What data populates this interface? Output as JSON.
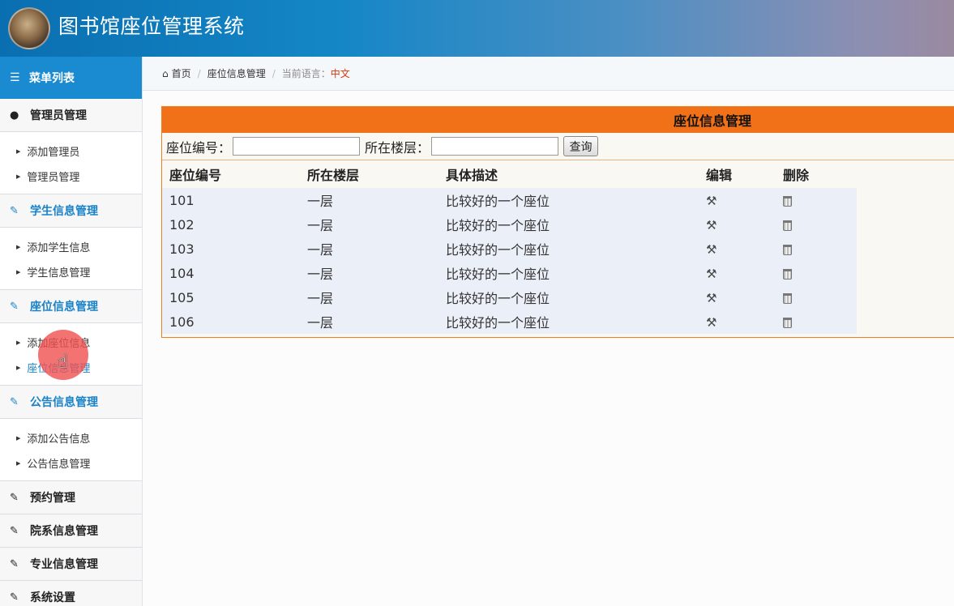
{
  "header": {
    "title": "图书馆座位管理系统",
    "logo_icon": "avatar"
  },
  "sidebar": {
    "menu_title": "菜单列表",
    "menu_icon": "list-icon",
    "groups": [
      {
        "label": "管理员管理",
        "icon": "user-icon",
        "items": [
          {
            "label": "添加管理员"
          },
          {
            "label": "管理员管理"
          }
        ]
      },
      {
        "label": "学生信息管理",
        "icon": "edit-icon",
        "items": [
          {
            "label": "添加学生信息"
          },
          {
            "label": "学生信息管理"
          }
        ]
      },
      {
        "label": "座位信息管理",
        "icon": "edit-icon",
        "items": [
          {
            "label": "添加座位信息"
          },
          {
            "label": "座位信息管理"
          }
        ]
      },
      {
        "label": "公告信息管理",
        "icon": "edit-icon",
        "items": [
          {
            "label": "添加公告信息"
          },
          {
            "label": "公告信息管理"
          }
        ]
      },
      {
        "label": "预约管理",
        "icon": "edit-icon"
      },
      {
        "label": "院系信息管理",
        "icon": "edit-icon"
      },
      {
        "label": "专业信息管理",
        "icon": "edit-icon"
      },
      {
        "label": "系统设置",
        "icon": "edit-icon"
      }
    ]
  },
  "breadcrumb": {
    "home": "首页",
    "current": "座位信息管理",
    "lang_label": "当前语言：",
    "lang_value": "中文"
  },
  "panel": {
    "title": "座位信息管理",
    "search": {
      "seat_label": "座位编号：",
      "seat_value": "",
      "floor_label": "所在楼层：",
      "floor_value": "",
      "query_button": "查询"
    },
    "columns": [
      "座位编号",
      "所在楼层",
      "具体描述",
      "编辑",
      "删除"
    ],
    "rows": [
      {
        "id": "101",
        "floor": "一层",
        "desc": "比较好的一个座位"
      },
      {
        "id": "102",
        "floor": "一层",
        "desc": "比较好的一个座位"
      },
      {
        "id": "103",
        "floor": "一层",
        "desc": "比较好的一个座位"
      },
      {
        "id": "104",
        "floor": "一层",
        "desc": "比较好的一个座位"
      },
      {
        "id": "105",
        "floor": "一层",
        "desc": "比较好的一个座位"
      },
      {
        "id": "106",
        "floor": "一层",
        "desc": "比较好的一个座位"
      }
    ]
  },
  "colors": {
    "header_accent": "#1a8bd1",
    "panel_header": "#f07118",
    "active_menu": "#1a82c8",
    "lang_value": "#d9350b"
  }
}
